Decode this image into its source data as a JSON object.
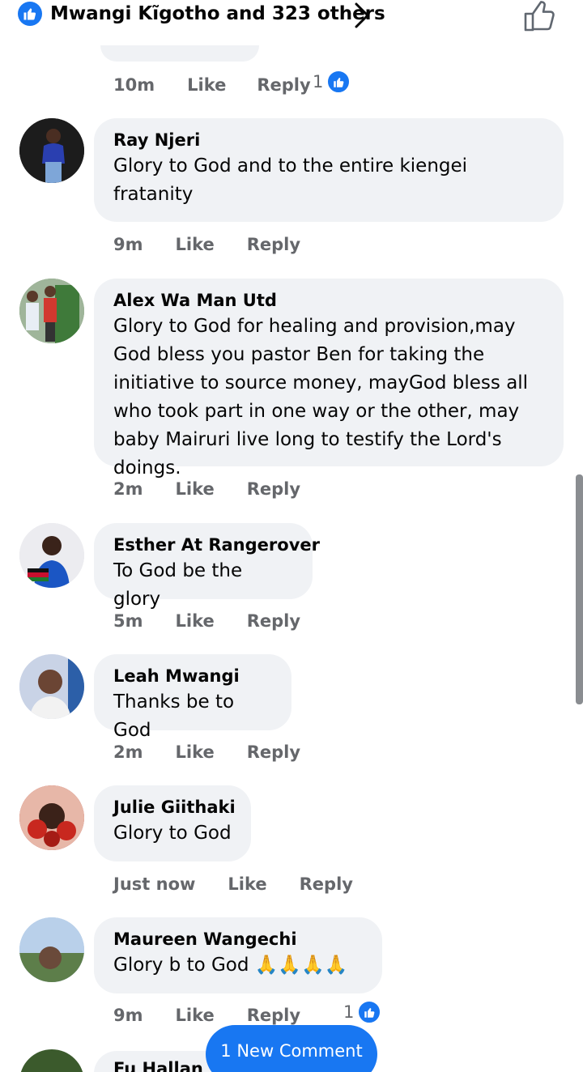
{
  "header": {
    "reactors_text": "Mwangi Kĩgotho and 323 others",
    "icons": {
      "reaction": "like-icon",
      "chevron": "chevron-right-icon",
      "like_button": "thumbs-up-outline-icon"
    }
  },
  "previous_comment": {
    "time": "10m",
    "like_label": "Like",
    "reply_label": "Reply",
    "reaction_count": "1"
  },
  "comments": [
    {
      "name": "Ray Njeri",
      "text": "Glory to God and to the entire kiengei fratanity",
      "time": "9m",
      "like_label": "Like",
      "reply_label": "Reply"
    },
    {
      "name": "Alex Wa Man Utd",
      "text": "Glory to God for healing and provision,may God bless you pastor Ben for taking the initiative to source money, mayGod bless all who took part in one way or the other, may baby Mairuri live long to testify the Lord's doings.",
      "time": "2m",
      "like_label": "Like",
      "reply_label": "Reply"
    },
    {
      "name": "Esther At Rangerover",
      "text": "To God be the glory",
      "time": "5m",
      "like_label": "Like",
      "reply_label": "Reply"
    },
    {
      "name": "Leah Mwangi",
      "text": "Thanks be to God",
      "time": "2m",
      "like_label": "Like",
      "reply_label": "Reply"
    },
    {
      "name": "Julie Giithaki",
      "text": "Glory to God",
      "time": "Just now",
      "like_label": "Like",
      "reply_label": "Reply"
    },
    {
      "name": "Maureen Wangechi",
      "text": "Glory b to God 🙏🙏🙏🙏",
      "time": "9m",
      "like_label": "Like",
      "reply_label": "Reply",
      "reaction_count": "1"
    }
  ],
  "next_comment": {
    "name_partial": "Fu Hallan W"
  },
  "new_comment_button": "1 New Comment",
  "colors": {
    "accent": "#1877f2",
    "bubble": "#f0f2f5",
    "meta": "#65676b"
  }
}
